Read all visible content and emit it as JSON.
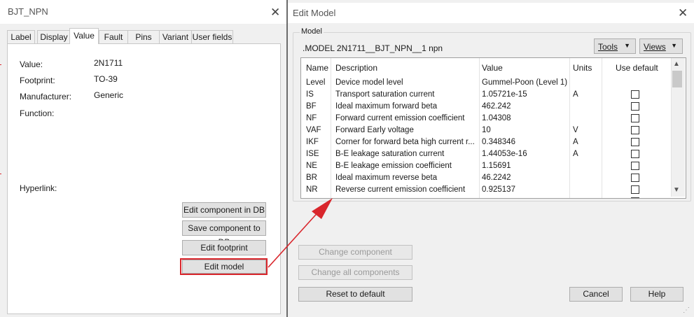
{
  "left_dialog": {
    "title": "BJT_NPN",
    "tabs": [
      "Label",
      "Display",
      "Value",
      "Fault",
      "Pins",
      "Variant",
      "User fields"
    ],
    "active_tab": "Value",
    "fields": [
      {
        "label": "Value:",
        "value": "2N1711"
      },
      {
        "label": "Footprint:",
        "value": "TO-39"
      },
      {
        "label": "Manufacturer:",
        "value": "Generic"
      },
      {
        "label": "Function:",
        "value": ""
      }
    ],
    "hyperlink_label": "Hyperlink:",
    "buttons": {
      "edit_component_db": "Edit component in DB",
      "save_component_db": "Save component to DB",
      "edit_footprint": "Edit footprint",
      "edit_model": "Edit model"
    }
  },
  "edit_model_dialog": {
    "title": "Edit Model",
    "group_label": "Model",
    "model_line": ".MODEL 2N1711__BJT_NPN__1 npn",
    "tools_label": "Tools",
    "views_label": "Views",
    "columns": [
      "Name",
      "Description",
      "Value",
      "Units",
      "Use default"
    ],
    "rows": [
      {
        "name": "Level",
        "description": "Device model level",
        "value": "Gummel-Poon (Level 1)",
        "units": "",
        "checkbox": false
      },
      {
        "name": "IS",
        "description": "Transport saturation current",
        "value": "1.05721e-15",
        "units": "A",
        "checkbox": true
      },
      {
        "name": "BF",
        "description": "Ideal maximum forward beta",
        "value": "462.242",
        "units": "",
        "checkbox": true
      },
      {
        "name": "NF",
        "description": "Forward current emission coefficient",
        "value": "1.04308",
        "units": "",
        "checkbox": true
      },
      {
        "name": "VAF",
        "description": "Forward Early voltage",
        "value": "10",
        "units": "V",
        "checkbox": true
      },
      {
        "name": "IKF",
        "description": "Corner for forward beta high current r...",
        "value": "0.348346",
        "units": "A",
        "checkbox": true
      },
      {
        "name": "ISE",
        "description": "B-E leakage saturation current",
        "value": "1.44053e-16",
        "units": "A",
        "checkbox": true
      },
      {
        "name": "NE",
        "description": "B-E leakage emission coefficient",
        "value": "1.15691",
        "units": "",
        "checkbox": true
      },
      {
        "name": "BR",
        "description": "Ideal maximum reverse beta",
        "value": "46.2242",
        "units": "",
        "checkbox": true
      },
      {
        "name": "NR",
        "description": "Reverse current emission coefficient",
        "value": "0.925137",
        "units": "",
        "checkbox": true
      }
    ],
    "buttons": {
      "change_component": "Change component",
      "change_all": "Change all components",
      "reset_default": "Reset to default",
      "cancel": "Cancel",
      "help": "Help"
    }
  },
  "colors": {
    "highlight": "#d9262c",
    "dialog_bg": "#f0f0f0",
    "button_bg": "#e1e1e1"
  },
  "icons": {
    "close": "close-icon",
    "dropdown": "chevron-down-icon",
    "scroll_up": "chevron-up-icon",
    "scroll_down": "chevron-down-icon",
    "resize": "resize-grip-icon",
    "annotation_arrow": "red-arrow-annotation"
  }
}
